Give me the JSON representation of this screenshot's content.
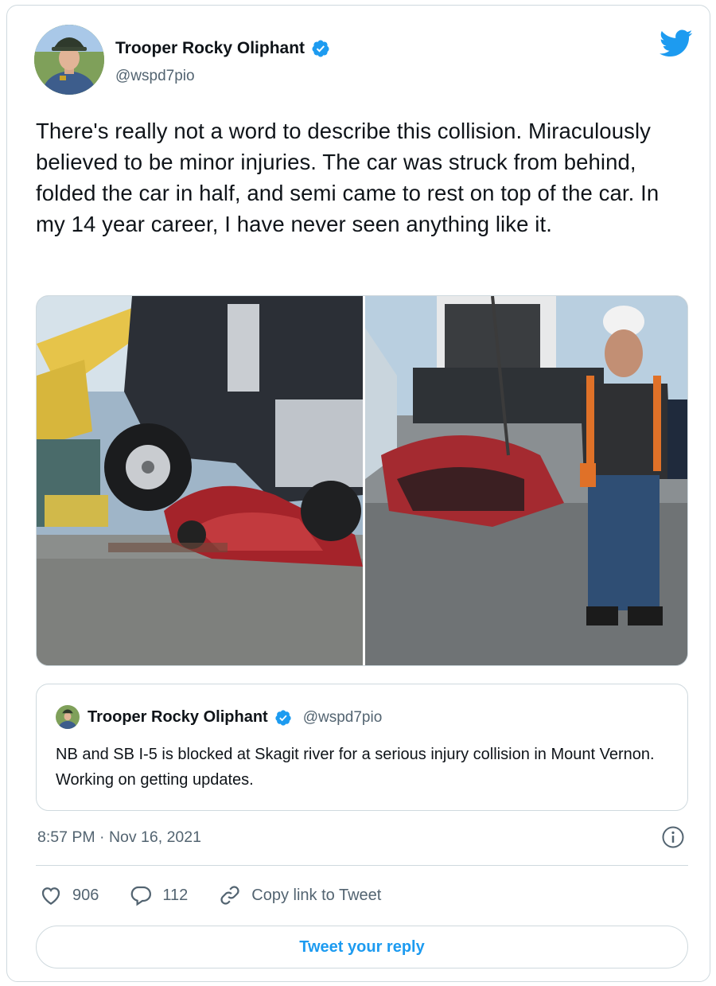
{
  "author": {
    "name": "Trooper Rocky Oliphant",
    "handle": "@wspd7pio",
    "verified": true,
    "avatar_icon": "trooper-avatar"
  },
  "platform_icon": "twitter-bird-icon",
  "tweet": {
    "text": "There's really not a word to describe this collision. Miraculously believed to be minor injuries. The car was struck from behind, folded the car in half, and semi came to rest on top of the car. In my 14 year career, I have never seen anything like it."
  },
  "quoted_tweet": {
    "name": "Trooper Rocky Oliphant",
    "handle": "@wspd7pio",
    "text": "NB and SB I-5 is blocked at Skagit river for a serious injury collision in Mount Vernon. Working on getting updates."
  },
  "timestamp": "8:57 PM · Nov 16, 2021",
  "actions": {
    "likes": "906",
    "replies": "112",
    "copy_link_label": "Copy link to Tweet"
  },
  "reply_button_label": "Tweet your reply",
  "colors": {
    "accent": "#1d9bf0",
    "secondary_text": "#536471",
    "border": "#cfd9de"
  }
}
